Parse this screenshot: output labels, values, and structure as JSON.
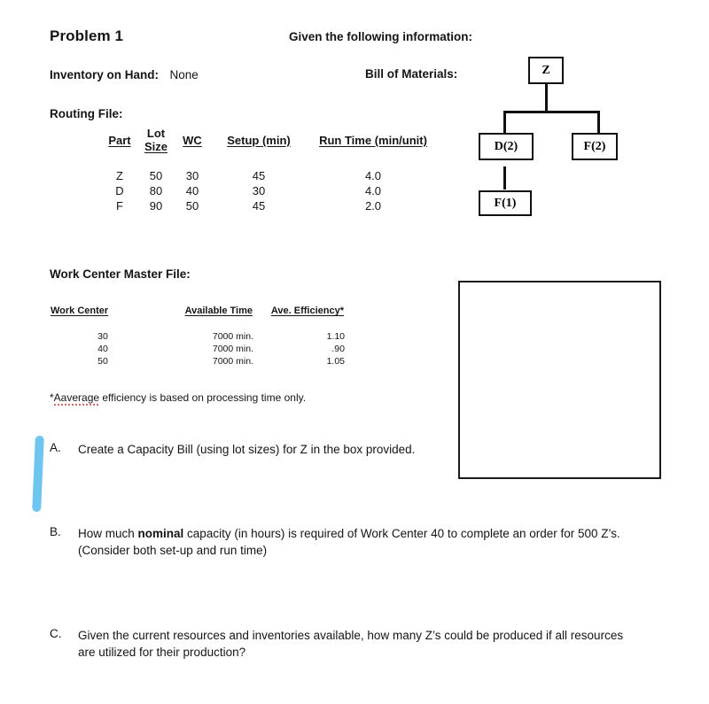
{
  "document": {
    "title": "Problem 1",
    "given_header": "Given the following information:",
    "inventory_label": "Inventory on Hand:",
    "inventory_value": "None",
    "routing_file_label": "Routing File:",
    "bill_of_materials_label": "Bill of Materials:",
    "work_center_master_label": "Work Center Master File:"
  },
  "routing_table": {
    "headers": {
      "part": "Part",
      "lot": "Lot",
      "size": "Size",
      "wc": "WC",
      "setup": "Setup (min)",
      "run_time": "Run Time (min/unit)"
    },
    "rows": [
      {
        "part": "Z",
        "lot_size": "50",
        "wc": "30",
        "setup": "45",
        "run_time": "4.0"
      },
      {
        "part": "D",
        "lot_size": "80",
        "wc": "40",
        "setup": "30",
        "run_time": "4.0"
      },
      {
        "part": "F",
        "lot_size": "90",
        "wc": "50",
        "setup": "45",
        "run_time": "2.0"
      }
    ]
  },
  "work_center_table": {
    "headers": {
      "work_center": "Work Center",
      "available_time": "Available Time",
      "efficiency": "Ave. Efficiency*"
    },
    "rows": [
      {
        "work_center": "30",
        "available_time": "7000 min.",
        "efficiency": "1.10"
      },
      {
        "work_center": "40",
        "available_time": "7000 min.",
        "efficiency": ".90"
      },
      {
        "work_center": "50",
        "available_time": "7000 min.",
        "efficiency": "1.05"
      }
    ],
    "footnote_marker": "*",
    "footnote_misspelled_word": "Aaverage",
    "footnote_rest": " efficiency is based on processing time only."
  },
  "bom": {
    "nodes": {
      "root": "Z",
      "child_left": "D(2)",
      "child_right": "F(2)",
      "grandchild": "F(1)"
    }
  },
  "questions": [
    {
      "letter": "A.",
      "text": "Create a Capacity Bill (using lot sizes) for Z in the box provided."
    },
    {
      "letter": "B.",
      "text_before_bold": "How much ",
      "bold": "nominal",
      "text_after_bold": " capacity (in hours) is required of Work Center 40 to complete an order for 500 Z’s.   (Consider both set-up and run time)"
    },
    {
      "letter": "C.",
      "text": "Given the current resources and inventories available, how many Z’s could be produced if all resources are utilized for their production?"
    }
  ],
  "annotations": {
    "blue_mark_color": "#6ec6f0"
  }
}
